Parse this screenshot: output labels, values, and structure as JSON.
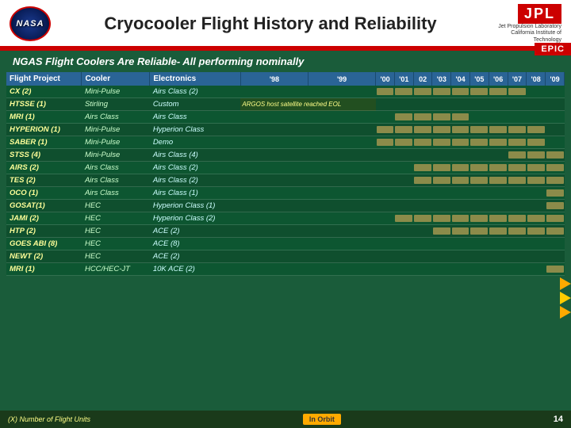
{
  "header": {
    "title": "Cryocooler Flight History and Reliability",
    "nasa_text": "NASA",
    "jpl_text": "JPL",
    "jpl_sub1": "Jet Propulsion Laboratory",
    "jpl_sub2": "California Institute of Technology",
    "epic": "EPIC"
  },
  "subtitle": "NGAS Flight Coolers Are Reliable- All performing nominally",
  "table": {
    "columns": {
      "project": "Flight Project",
      "cooler": "Cooler",
      "electronics": "Electronics",
      "years": [
        "'98",
        "'99",
        "'00",
        "'01",
        "02",
        "'03",
        "'04",
        "'05",
        "'06",
        "'07",
        "'08",
        "'09"
      ]
    },
    "rows": [
      {
        "project": "CX (2)",
        "cooler": "Mini-Pulse",
        "electronics": "Airs Class (2)",
        "bars": [
          0,
          0,
          1,
          1,
          1,
          1,
          1,
          1,
          1,
          1,
          0,
          0
        ]
      },
      {
        "project": "HTSSE (1)",
        "cooler": "Stirling",
        "electronics": "Custom",
        "bars": [
          1,
          1,
          0,
          0,
          0,
          0,
          0,
          0,
          0,
          0,
          0,
          0
        ],
        "note": "ARGOS host satellite reached EOL"
      },
      {
        "project": "MRI (1)",
        "cooler": "Airs Class",
        "electronics": "Airs Class",
        "bars": [
          0,
          0,
          0,
          1,
          1,
          1,
          1,
          0,
          0,
          0,
          0,
          0
        ]
      },
      {
        "project": "HYPERION (1)",
        "cooler": "Mini-Pulse",
        "electronics": "Hyperion Class",
        "bars": [
          0,
          0,
          1,
          1,
          1,
          1,
          1,
          1,
          1,
          1,
          1,
          0
        ]
      },
      {
        "project": "SABER (1)",
        "cooler": "Mini-Pulse",
        "electronics": "Demo",
        "bars": [
          0,
          0,
          1,
          1,
          1,
          1,
          1,
          1,
          1,
          1,
          1,
          0
        ]
      },
      {
        "project": "STSS (4)",
        "cooler": "Mini-Pulse",
        "electronics": "Airs Class (4)",
        "bars": [
          0,
          0,
          0,
          0,
          0,
          0,
          0,
          0,
          0,
          1,
          1,
          1
        ]
      },
      {
        "project": "AIRS (2)",
        "cooler": "Airs Class",
        "electronics": "Airs Class (2)",
        "bars": [
          0,
          0,
          0,
          0,
          1,
          1,
          1,
          1,
          1,
          1,
          1,
          1
        ]
      },
      {
        "project": "TES (2)",
        "cooler": "Airs Class",
        "electronics": "Airs Class (2)",
        "bars": [
          0,
          0,
          0,
          0,
          1,
          1,
          1,
          1,
          1,
          1,
          1,
          1
        ]
      },
      {
        "project": "OCO (1)",
        "cooler": "Airs Class",
        "electronics": "Airs Class (1)",
        "bars": [
          0,
          0,
          0,
          0,
          0,
          0,
          0,
          0,
          0,
          0,
          0,
          1
        ]
      },
      {
        "project": "GOSAT(1)",
        "cooler": "HEC",
        "electronics": "Hyperion Class (1)",
        "bars": [
          0,
          0,
          0,
          0,
          0,
          0,
          0,
          0,
          0,
          0,
          0,
          1
        ]
      },
      {
        "project": "JAMI (2)",
        "cooler": "HEC",
        "electronics": "Hyperion Class (2)",
        "bars": [
          0,
          0,
          0,
          1,
          1,
          1,
          1,
          1,
          1,
          1,
          1,
          1
        ]
      },
      {
        "project": "HTP (2)",
        "cooler": "HEC",
        "electronics": "ACE (2)",
        "bars": [
          0,
          0,
          0,
          0,
          0,
          1,
          1,
          1,
          1,
          1,
          1,
          1
        ]
      },
      {
        "project": "GOES ABI (8)",
        "cooler": "HEC",
        "electronics": "ACE (8)",
        "bars": [
          0,
          0,
          0,
          0,
          0,
          0,
          0,
          0,
          0,
          0,
          0,
          0
        ]
      },
      {
        "project": "NEWT (2)",
        "cooler": "HEC",
        "electronics": "ACE (2)",
        "bars": [
          0,
          0,
          0,
          0,
          0,
          0,
          0,
          0,
          0,
          0,
          0,
          0
        ]
      },
      {
        "project": "MRI (1)",
        "cooler": "HCC/HEC-JT",
        "electronics": "10K ACE (2)",
        "bars": [
          0,
          0,
          0,
          0,
          0,
          0,
          0,
          0,
          0,
          0,
          0,
          1
        ]
      }
    ]
  },
  "bottom": {
    "note": "(X) Number of Flight Units",
    "in_orbit": "In Orbit",
    "page": "14"
  },
  "colors": {
    "bar_active": "#8b8b4a",
    "bar_pending": "#999966",
    "header_bg": "#2a5080",
    "bg_green": "#1a5c3a"
  }
}
